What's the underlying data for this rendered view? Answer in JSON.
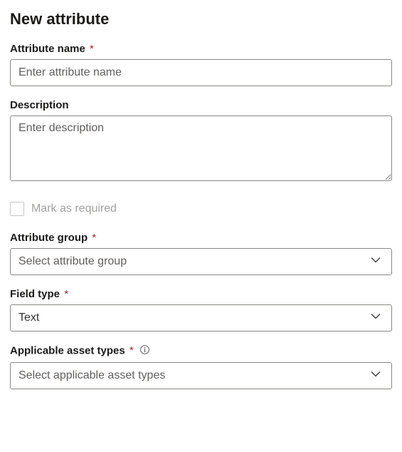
{
  "header": {
    "title": "New attribute"
  },
  "fields": {
    "attribute_name": {
      "label": "Attribute name",
      "required_marker": "*",
      "placeholder": "Enter attribute name",
      "value": ""
    },
    "description": {
      "label": "Description",
      "placeholder": "Enter description",
      "value": ""
    },
    "mark_required": {
      "label": "Mark as required",
      "checked": false
    },
    "attribute_group": {
      "label": "Attribute group",
      "required_marker": "*",
      "placeholder": "Select attribute group",
      "value": ""
    },
    "field_type": {
      "label": "Field type",
      "required_marker": "*",
      "value": "Text"
    },
    "applicable_asset_types": {
      "label": "Applicable asset types",
      "required_marker": "*",
      "placeholder": "Select applicable asset types",
      "value": ""
    }
  }
}
